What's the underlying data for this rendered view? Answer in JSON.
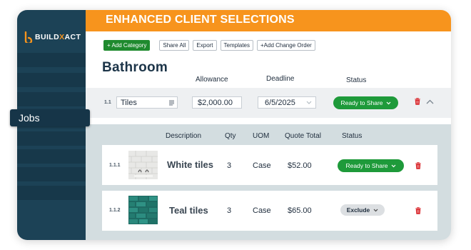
{
  "brand": {
    "prefix": "BUILD",
    "accent": "X",
    "suffix": "ACT",
    "color": "#f7941d"
  },
  "sidebar": {
    "jobs_label": "Jobs"
  },
  "header": {
    "title": "ENHANCED CLIENT SELECTIONS"
  },
  "toolbar": {
    "add_category": "+ Add Category",
    "share_all": "Share All",
    "export": "Export",
    "templates": "Templates",
    "add_change_order": "+Add Change Order"
  },
  "section": {
    "title": "Bathroom",
    "col_allowance": "Allowance",
    "col_deadline": "Deadline",
    "col_status": "Status"
  },
  "category_row": {
    "number": "1.1",
    "name": "Tiles",
    "allowance": "$2,000.00",
    "deadline": "6/5/2025",
    "status": "Ready to Share"
  },
  "items_header": {
    "description": "Description",
    "qty": "Qty",
    "uom": "UOM",
    "quote_total": "Quote Total",
    "status": "Status"
  },
  "items": [
    {
      "number": "1.1.1",
      "name": "White tiles",
      "qty": "3",
      "uom": "Case",
      "total": "$52.00",
      "status": "Ready to Share"
    },
    {
      "number": "1.1.2",
      "name": "Teal tiles",
      "qty": "3",
      "uom": "Case",
      "total": "$65.00",
      "status": "Exclude"
    }
  ],
  "colors": {
    "sidebar": "#1c4256",
    "header": "#f7941d",
    "success": "#1e9a3a",
    "delete": "#d9262b"
  }
}
